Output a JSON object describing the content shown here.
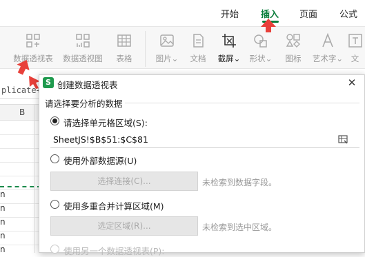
{
  "ribbon_tabs": [
    {
      "label": "开始",
      "active": false
    },
    {
      "label": "插入",
      "active": true
    },
    {
      "label": "页面",
      "active": false
    },
    {
      "label": "公式",
      "active": false
    }
  ],
  "ribbon_buttons": [
    {
      "label": "数据透视表",
      "icon": "pivot-table-icon",
      "enabled": false
    },
    {
      "label": "数据透视图",
      "icon": "pivot-chart-icon",
      "enabled": false
    },
    {
      "label": "表格",
      "icon": "table-icon",
      "enabled": false
    },
    {
      "label": "图片⌄",
      "icon": "picture-icon",
      "enabled": false
    },
    {
      "label": "文档",
      "icon": "document-icon",
      "enabled": false
    },
    {
      "label": "截屏⌄",
      "icon": "screenshot-icon",
      "enabled": true
    },
    {
      "label": "形状⌄",
      "icon": "shape-icon",
      "enabled": false
    },
    {
      "label": "图标",
      "icon": "icons-icon",
      "enabled": false
    },
    {
      "label": "艺术字⌄",
      "icon": "word-art-icon",
      "enabled": false
    },
    {
      "label": "文",
      "icon": "text-box-icon",
      "enabled": false
    }
  ],
  "sheet": {
    "formula_text": "plicate+",
    "column_header": "B",
    "row_chars": [
      "n",
      "n",
      "n",
      "n",
      "n"
    ]
  },
  "dialog": {
    "title": "创建数据透视表",
    "logo": "S",
    "close": "✕",
    "section_title": "请选择要分析的数据",
    "option_cell_range": "请选择单元格区域(S):",
    "range_value": "SheetJS!$B$51:$C$81",
    "option_external": "使用外部数据源(U)",
    "select_connection_button": "选择连接(C)...",
    "hint_no_fields": "未检索到数据字段。",
    "option_multi_consolidate": "使用多重合并计算区域(M)",
    "select_region_button": "选定区域(R)...",
    "hint_no_region": "未检索到选中区域。",
    "option_other_pivot": "使用另一个数据透视表(P):"
  },
  "colors": {
    "accent": "#0a7d3b",
    "annotation_red": "#e8403a",
    "logo_green": "#1e9a4d"
  }
}
